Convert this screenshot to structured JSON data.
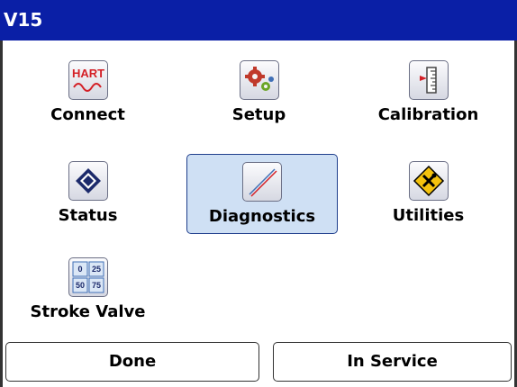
{
  "window": {
    "title": "V15"
  },
  "menu": {
    "connect": {
      "label": "Connect",
      "icon": "hart-icon",
      "icon_text": "HART"
    },
    "setup": {
      "label": "Setup",
      "icon": "gears-icon"
    },
    "calibration": {
      "label": "Calibration",
      "icon": "ruler-arrow-icon"
    },
    "status": {
      "label": "Status",
      "icon": "diamond-icon"
    },
    "diagnostics": {
      "label": "Diagnostics",
      "icon": "signature-line-icon",
      "selected": true
    },
    "utilities": {
      "label": "Utilities",
      "icon": "tools-warning-icon"
    },
    "stroke_valve": {
      "label": "Stroke Valve",
      "icon": "stroke-grid-icon",
      "cells": [
        "0",
        "25",
        "50",
        "75"
      ]
    }
  },
  "buttons": {
    "done": "Done",
    "in_service": "In Service"
  },
  "colors": {
    "titlebar": "#0a1fa6",
    "selection": "#cfe0f4",
    "hart_red": "#d41f26"
  }
}
